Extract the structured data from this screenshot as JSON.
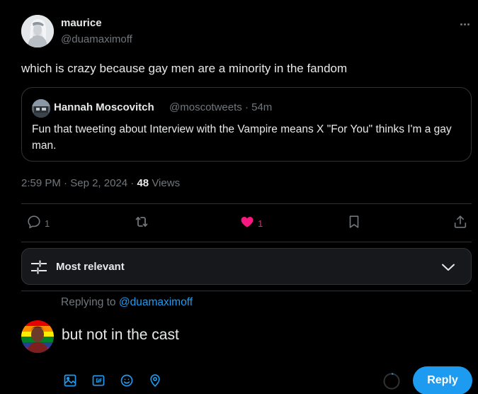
{
  "tweet": {
    "author_name": "maurice",
    "author_handle": "@duamaximoff",
    "text": "which is crazy because gay men are a minority in the fandom",
    "time": "2:59 PM",
    "date": "Sep 2, 2024",
    "views_count": "48",
    "views_label": "Views"
  },
  "quote": {
    "author_name": "Hannah Moscovitch",
    "author_handle": "@moscotweets",
    "age": "54m",
    "text": "Fun that tweeting about Interview with the Vampire means X \"For You\" thinks I'm a gay man."
  },
  "actions": {
    "replies_count": "1",
    "likes_count": "1",
    "liked": true
  },
  "sort": {
    "label": "Most relevant"
  },
  "reply": {
    "replying_prefix": "Replying to",
    "replying_handle": "@duamaximoff",
    "input_text": "but not in the cast",
    "submit_label": "Reply"
  },
  "colors": {
    "accent": "#1d9bf0",
    "like": "#f91880",
    "secondary_text": "#71767b",
    "border": "#2f3336"
  },
  "icons": [
    "more-icon",
    "reply-icon",
    "retweet-icon",
    "like-icon",
    "bookmark-icon",
    "share-icon",
    "sort-settings-icon",
    "chevron-down-icon",
    "media-icon",
    "gif-icon",
    "emoji-icon",
    "location-icon"
  ]
}
